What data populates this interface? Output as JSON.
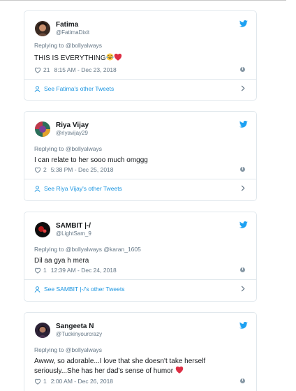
{
  "tweets": [
    {
      "name": "Fatima",
      "handle": "@FatimaDixit",
      "replying_to": "Replying to @bollyalways",
      "text": "THIS IS EVERYTHING",
      "likes": "21",
      "timestamp": "8:15 AM - Dec 23, 2018",
      "more_link": "See Fatima's other Tweets"
    },
    {
      "name": "Riya Vijay",
      "handle": "@riyavijay29",
      "replying_to": "Replying to @bollyalways",
      "text": "I can relate to her sooo much omggg",
      "likes": "2",
      "timestamp": "5:38 PM - Dec 25, 2018",
      "more_link": "See Riya Vijay's other Tweets"
    },
    {
      "name": "SAMBIT |-/",
      "handle": "@LightSam_9",
      "replying_to": "Replying to @bollyalways @karan_1605",
      "text": "Dil aa gya h mera",
      "likes": "1",
      "timestamp": "12:39 AM - Dec 24, 2018",
      "more_link": "See SAMBIT |-/'s other Tweets"
    },
    {
      "name": "Sangeeta N",
      "handle": "@Tuckinyourcrazy",
      "replying_to": "Replying to @bollyalways",
      "text_line1": "Awww, so adorable...I love that she doesn't take herself",
      "text_line2": "seriously...She has her dad's sense of humor",
      "likes": "1",
      "timestamp": "2:00 AM - Dec 26, 2018"
    }
  ],
  "icons": {
    "bird": "twitter-bird-icon",
    "like": "heart-outline-icon",
    "info": "info-icon",
    "person": "person-icon",
    "chevron": "chevron-right-icon",
    "laugh": "tears-of-joy-emoji",
    "heart": "red-heart-emoji"
  },
  "colors": {
    "accent": "#1da1f2",
    "link": "#1b95e0",
    "muted": "#657786",
    "border": "#e1e8ed",
    "heart": "#e0245e"
  }
}
